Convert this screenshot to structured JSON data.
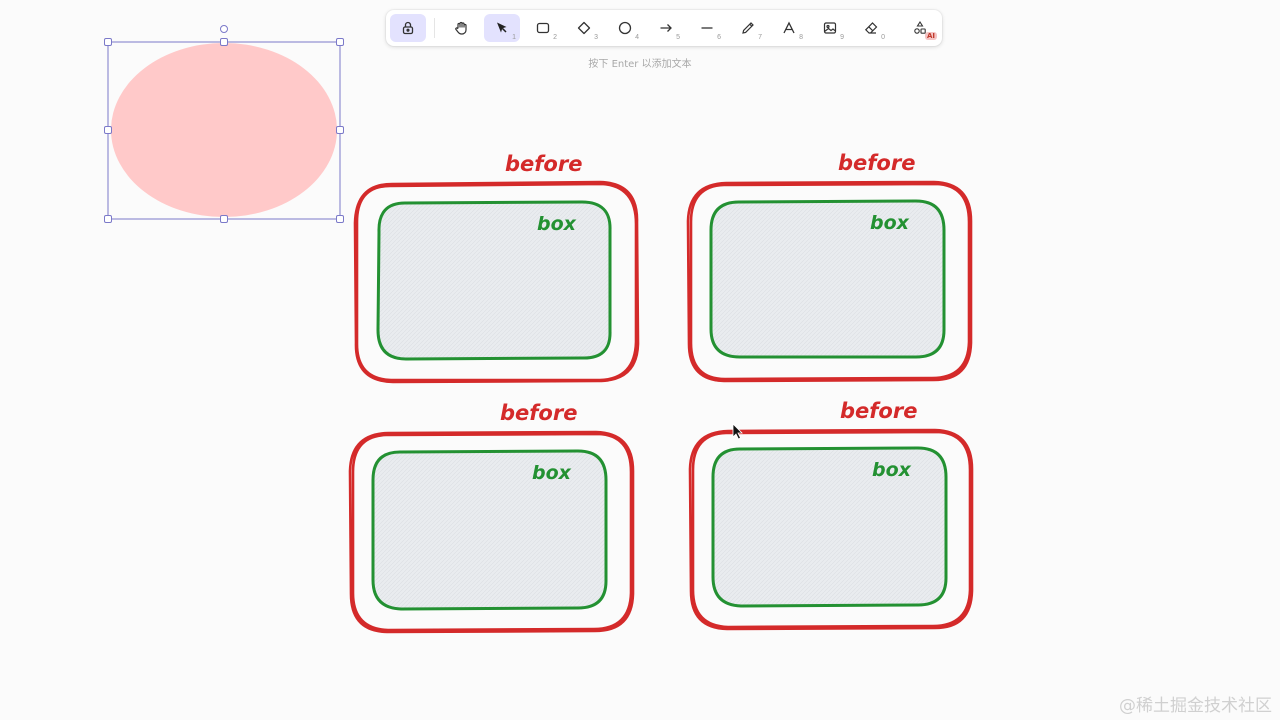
{
  "toolbar": {
    "tools": [
      {
        "id": "lock",
        "num": ""
      },
      {
        "id": "hand",
        "num": ""
      },
      {
        "id": "select",
        "num": "1"
      },
      {
        "id": "rectangle",
        "num": "2"
      },
      {
        "id": "diamond",
        "num": "3"
      },
      {
        "id": "ellipse",
        "num": "4"
      },
      {
        "id": "arrow",
        "num": "5"
      },
      {
        "id": "line",
        "num": "6"
      },
      {
        "id": "draw",
        "num": "7"
      },
      {
        "id": "text",
        "num": "8"
      },
      {
        "id": "image",
        "num": "9"
      },
      {
        "id": "eraser",
        "num": "0"
      },
      {
        "id": "more-tools",
        "num": ""
      }
    ],
    "ai_badge": "AI",
    "selected_tool": "select"
  },
  "hint": "按下 Enter 以添加文本",
  "canvas": {
    "selected_shape": {
      "type": "ellipse",
      "fill": "#ffc9c9",
      "selection_color": "#7b79c9"
    },
    "groups": [
      {
        "outer_label": "before",
        "inner_label": "box"
      },
      {
        "outer_label": "before",
        "inner_label": "box"
      },
      {
        "outer_label": "before",
        "inner_label": "box"
      },
      {
        "outer_label": "before",
        "inner_label": "box"
      }
    ],
    "colors": {
      "outer_stroke": "#d42a2a",
      "inner_stroke": "#239132",
      "inner_fill": "#e9ecef",
      "label_before": "#d42a2a",
      "label_box": "#239132"
    }
  },
  "watermark": "@稀土掘金技术社区"
}
